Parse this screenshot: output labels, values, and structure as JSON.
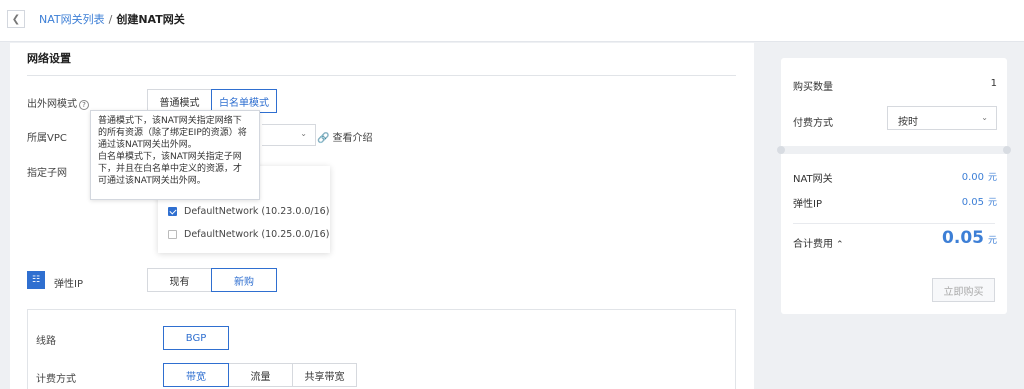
{
  "header": {
    "back_icon": "chevron-left-icon",
    "breadcrumb_parent": "NAT网关列表",
    "breadcrumb_sep": "/",
    "breadcrumb_current": "创建NAT网关"
  },
  "network": {
    "section_title": "网络设置",
    "outbound_mode_label": "出外网模式",
    "outbound_modes": [
      "普通模式",
      "白名单模式"
    ],
    "outbound_mode_selected": "白名单模式",
    "vpc_label": "所属VPC",
    "vpc_link": "查看介绍",
    "subnet_label": "指定子网",
    "tooltip_lines": [
      "普通模式下，该NAT网关指定网络下",
      "的所有资源（除了绑定EIP的资源）将",
      "通过该NAT网关出外网。",
      "白名单模式下，该NAT网关指定子网",
      "下，并且在白名单中定义的资源，才",
      "可通过该NAT网关出外网。"
    ],
    "subnets": [
      {
        "label": "DefaultNetwork (10.23.0.0/16)",
        "checked": true
      },
      {
        "label": "DefaultNetwork (10.25.0.0/16)",
        "checked": false
      }
    ]
  },
  "eip": {
    "label": "弹性IP",
    "modes": [
      "现有",
      "新购"
    ],
    "mode_selected": "新购",
    "line_label": "线路",
    "line_value": "BGP",
    "billing_label": "计费方式",
    "billing_options": [
      "带宽",
      "流量",
      "共享带宽"
    ],
    "billing_selected": "带宽"
  },
  "summary": {
    "quantity_label": "购买数量",
    "quantity_value": "1",
    "payment_label": "付费方式",
    "payment_value": "按时",
    "items": [
      {
        "label": "NAT网关",
        "price": "0.00",
        "unit": "元"
      },
      {
        "label": "弹性IP",
        "price": "0.05",
        "unit": "元"
      }
    ],
    "total_label": "合计费用",
    "total_value": "0.05",
    "total_unit": "元",
    "buy_label": "立即购买"
  },
  "colors": {
    "accent": "#2f6fd0",
    "link": "#3d7fd6",
    "background": "#eef0f3"
  }
}
